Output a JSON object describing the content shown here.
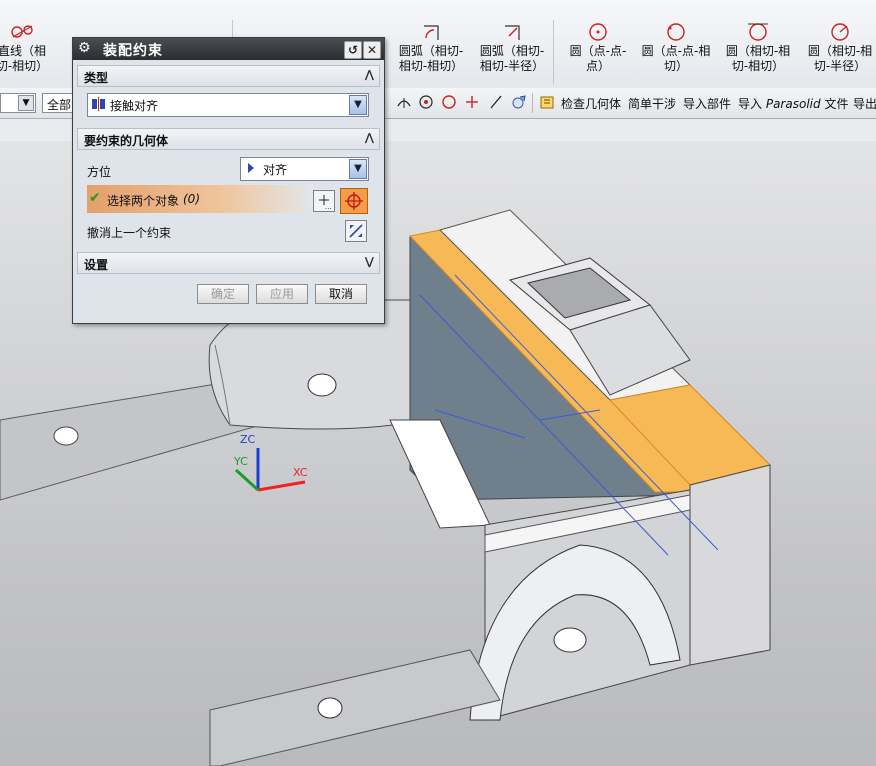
{
  "ribbon": {
    "items": [
      {
        "label": "直线（相切-相切）",
        "icon": "line-tangent-icon"
      },
      {
        "label": "圆弧（相切-相切-相切）",
        "icon": "arc-tangent-icon"
      },
      {
        "label": "圆弧（相切-相切-半径）",
        "icon": "arc-radius-icon"
      },
      {
        "label": "圆（点-点-点）",
        "icon": "circle-3pt-icon"
      },
      {
        "label": "圆（点-点-相切）",
        "icon": "circle-pt-tangent-icon"
      },
      {
        "label": "圆（相切-相切-相切）",
        "icon": "circle-3tangent-icon"
      },
      {
        "label": "圆（相切-相切-半径）",
        "icon": "circle-tangent-radius-icon"
      }
    ]
  },
  "toolbar": {
    "filter_value": "全部",
    "check_geometry": "检查几何体",
    "simple_interference": "简单干涉",
    "import_part": "导入部件",
    "import_parasolid_prefix": "导入",
    "import_parasolid_name": "Parasolid",
    "import_parasolid_suffix": "文件",
    "export": "导出"
  },
  "dialog": {
    "title": "装配约束",
    "type_section": "类型",
    "type_value": "接触对齐",
    "geometry_section": "要约束的几何体",
    "orientation_label": "方位",
    "orientation_value": "对齐",
    "select_label": "选择两个对象",
    "select_count": "(0)",
    "undo_label": "撤消上一个约束",
    "settings_section": "设置",
    "ok": "确定",
    "apply": "应用",
    "cancel": "取消"
  },
  "triad": {
    "z": "ZC",
    "y": "YC",
    "x": "XC"
  },
  "colors": {
    "selection_face": "#f7b955",
    "dialog_title": "#2b2d31",
    "highlight_button": "#f39c4a"
  }
}
